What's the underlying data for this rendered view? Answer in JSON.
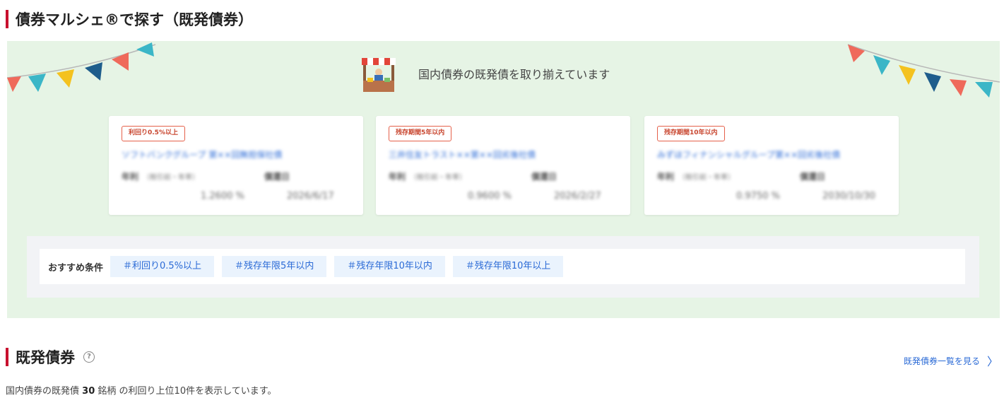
{
  "section1": {
    "title": "債券マルシェ®で探す（既発債券）"
  },
  "marche": {
    "intro": "国内債券の既発債を取り揃えています",
    "cards": [
      {
        "badge": "利回り0.5%以上",
        "name": "ソフトバンクグループ 第××回無担保社債",
        "key1": "年利",
        "key1_note": "（税引前・年率）",
        "key2": "償還日",
        "val1": "1.2600 %",
        "val2": "2026/6/17"
      },
      {
        "badge": "残存期間5年以内",
        "name": "三井住友トラスト××第××回劣後社債",
        "key1": "年利",
        "key1_note": "（税引前・年率）",
        "key2": "償還日",
        "val1": "0.9600 %",
        "val2": "2026/2/27"
      },
      {
        "badge": "残存期間10年以内",
        "name": "みずほフィナンシャルグループ第××回劣後社債",
        "key1": "年利",
        "key1_note": "（税引前・年率）",
        "key2": "償還日",
        "val1": "0.9750 %",
        "val2": "2030/10/30"
      }
    ],
    "conditions": {
      "label": "おすすめ条件",
      "tags": [
        "＃利回り0.5%以上",
        "＃残存年限5年以内",
        "＃残存年限10年以内",
        "＃残存年限10年以上"
      ]
    }
  },
  "section2": {
    "title": "既発債券",
    "help_icon": "?",
    "link": "既発債券一覧を見る",
    "link_chevron": "〉",
    "footnote_pre": "国内債券の既発債",
    "footnote_count": "30",
    "footnote_mid": "銘柄",
    "footnote_post": "の利回り上位10件を表示しています。"
  },
  "colors": {
    "accent_red": "#c8102e",
    "link_blue": "#2a6ad6",
    "marche_bg": "#e6f4e5"
  }
}
